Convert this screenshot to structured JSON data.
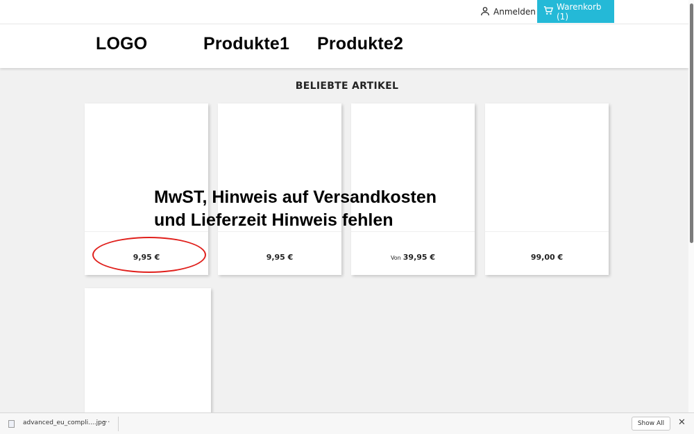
{
  "topbar": {
    "login_label": "Anmelden",
    "cart_label": "Warenkorb (1)",
    "cart_color": "#24b9d7"
  },
  "header": {
    "logo": "LOGO",
    "nav": [
      "Produkte1",
      "Produkte2"
    ]
  },
  "section": {
    "title": "BELIEBTE ARTIKEL"
  },
  "products": [
    {
      "price": "9,95 €",
      "prefix": ""
    },
    {
      "price": "9,95 €",
      "prefix": ""
    },
    {
      "price": "39,95 €",
      "prefix": "Von"
    },
    {
      "price": "99,00 €",
      "prefix": ""
    }
  ],
  "annotation": {
    "line1": "MwST, Hinweis auf Versandkosten",
    "line2": "und Lieferzeit Hinweis fehlen",
    "highlight_color": "#e0201c"
  },
  "download_bar": {
    "file_name": "advanced_eu_compli....jpg",
    "more": "···",
    "show_all": "Show All",
    "close": "✕"
  },
  "icons": {
    "login": "user-icon",
    "cart": "shopping-cart-icon",
    "file": "file-icon",
    "close": "close-icon"
  }
}
